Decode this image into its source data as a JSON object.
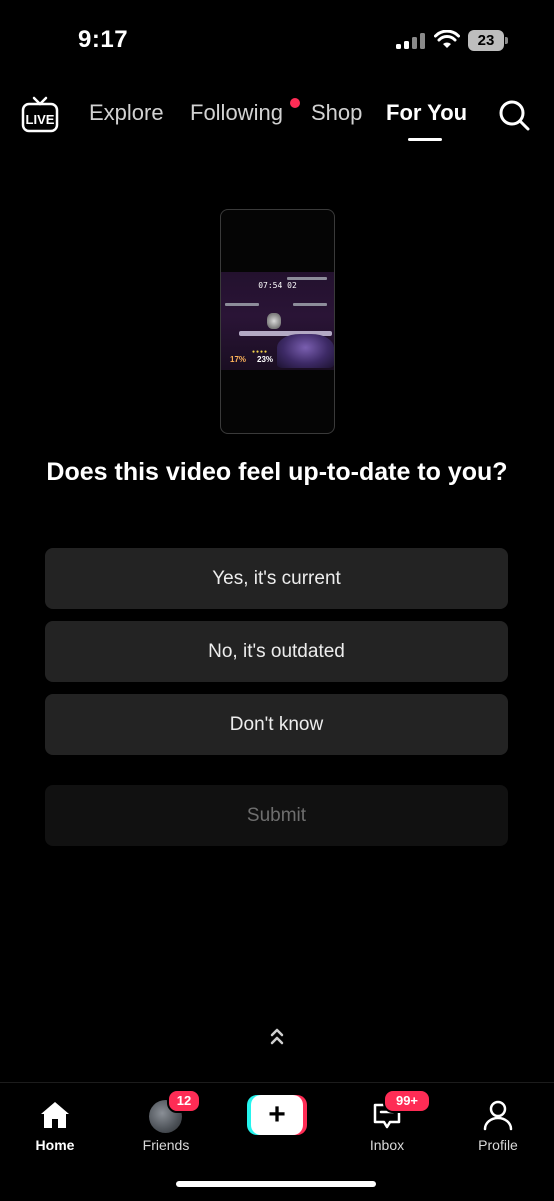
{
  "status_bar": {
    "time": "9:17",
    "battery": "23"
  },
  "top_nav": {
    "live_label": "LIVE",
    "tabs": [
      {
        "label": "Explore",
        "active": false
      },
      {
        "label": "Following",
        "active": false,
        "has_dot": true
      },
      {
        "label": "Shop",
        "active": false
      },
      {
        "label": "For You",
        "active": true
      }
    ]
  },
  "preview": {
    "timer": "07:54 02",
    "player1_percent": "17%",
    "player2_percent": "23%"
  },
  "survey": {
    "question": "Does this video feel up-to-date to you?",
    "options": [
      "Yes, it's current",
      "No, it's outdated",
      "Don't know"
    ],
    "submit_label": "Submit"
  },
  "bottom_nav": {
    "items": [
      {
        "label": "Home",
        "active": true
      },
      {
        "label": "Friends",
        "badge": "12"
      },
      {
        "label": "Inbox",
        "badge": "99+"
      },
      {
        "label": "Profile"
      }
    ],
    "create_label": "+"
  },
  "colors": {
    "accent_red": "#fe2c55",
    "accent_cyan": "#25f4ee",
    "background": "#000000",
    "option_bg": "#232323"
  }
}
